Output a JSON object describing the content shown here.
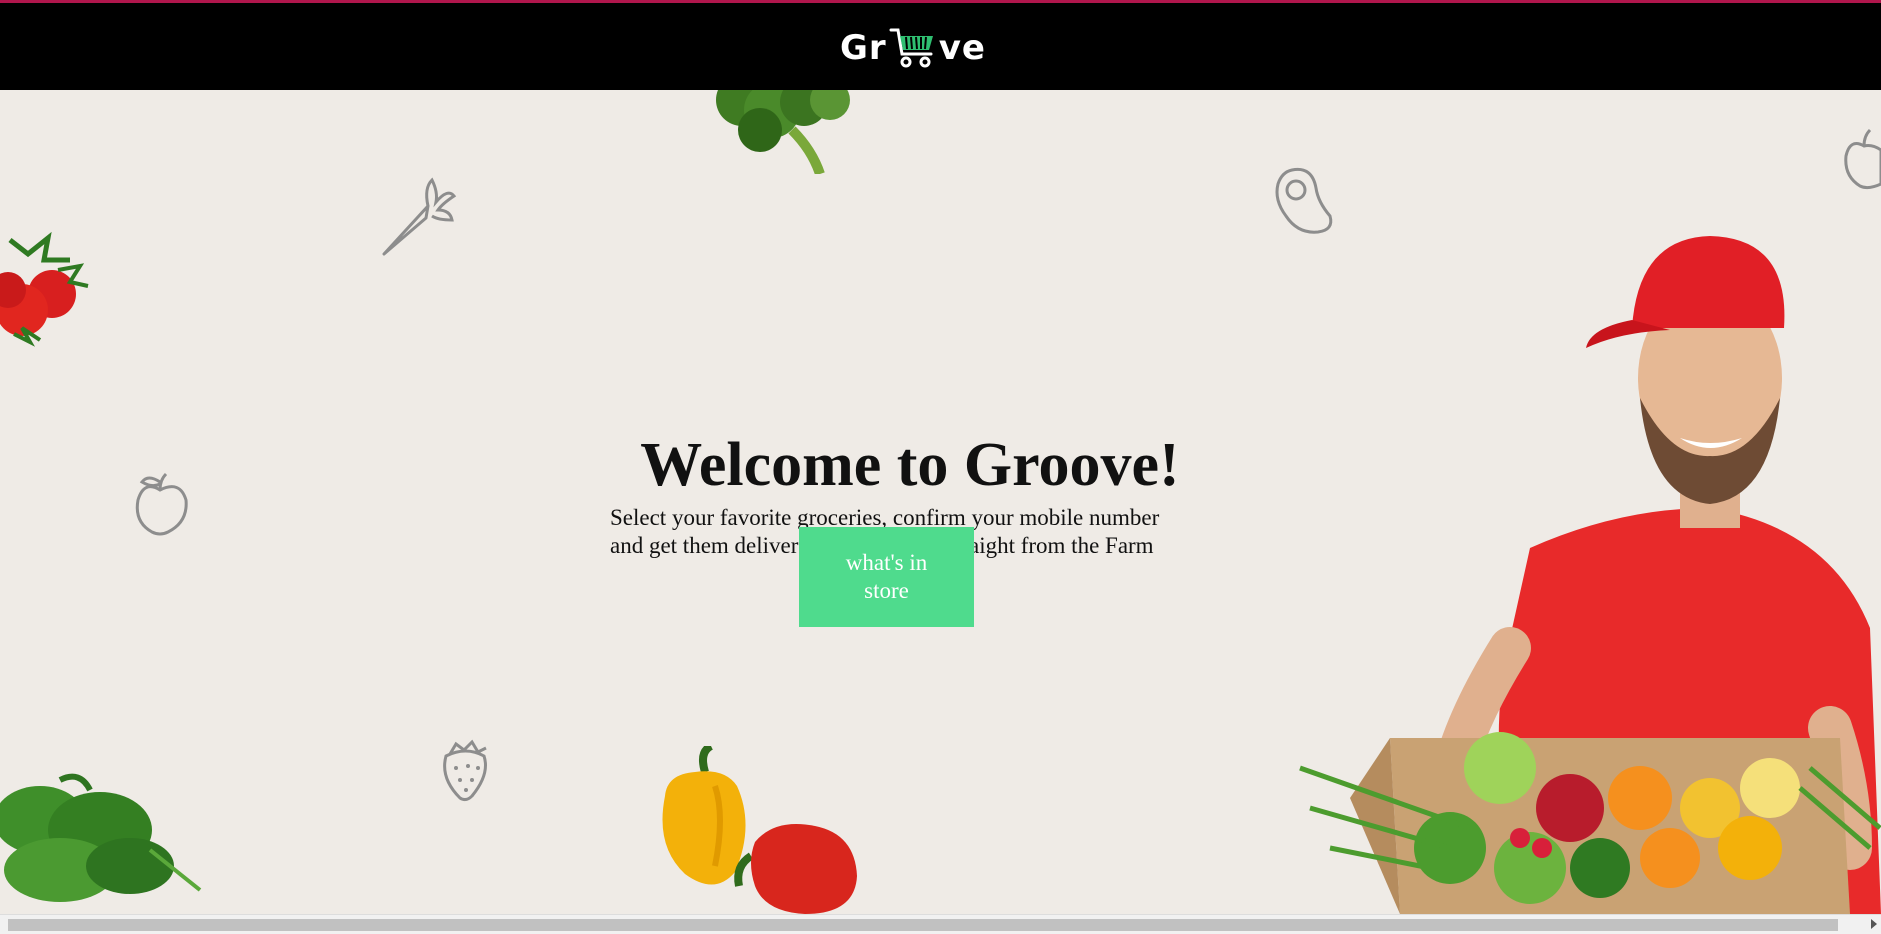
{
  "header": {
    "logo_text_left": "Gr",
    "logo_text_right": "ve",
    "logo_icon": "shopping-cart-icon",
    "accent_color": "#b0164c",
    "cart_color": "#2fbf71"
  },
  "hero": {
    "title": "Welcome to Groove!",
    "subtitle_line1": "Select your favorite groceries, confirm your mobile number",
    "subtitle_line2": "and get them delivered in 30 mins - Straight from the Farm",
    "cta_label": "what's in store",
    "cta_color": "#4fdb8d"
  },
  "decorations": [
    "broccoli-image",
    "carrot-icon",
    "avocado-icon",
    "apple-icon",
    "strawberry-icon",
    "tomatoes-image",
    "spinach-image",
    "bell-peppers-image",
    "delivery-man-image"
  ]
}
